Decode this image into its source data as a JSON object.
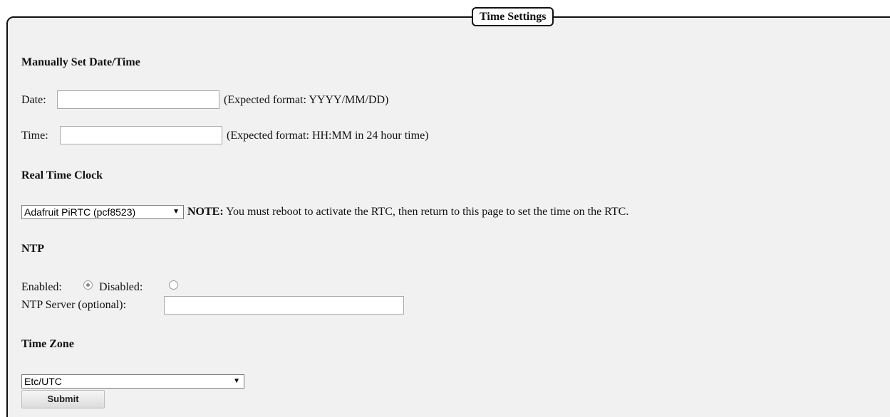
{
  "fieldset": {
    "legend": "Time Settings"
  },
  "manual": {
    "heading": "Manually Set Date/Time",
    "date_label": "Date:",
    "date_value": "",
    "date_hint": "(Expected format: YYYY/MM/DD)",
    "time_label": "Time:",
    "time_value": "",
    "time_hint": "(Expected format: HH:MM in 24 hour time)"
  },
  "rtc": {
    "heading": "Real Time Clock",
    "selected": "Adafruit PiRTC (pcf8523)",
    "note_label": "NOTE:",
    "note_text": "You must reboot to activate the RTC, then return to this page to set the time on the RTC."
  },
  "ntp": {
    "heading": "NTP",
    "enabled_label": "Enabled:",
    "disabled_label": "Disabled:",
    "enabled_checked": true,
    "server_label": "NTP Server (optional):",
    "server_value": ""
  },
  "timezone": {
    "heading": "Time Zone",
    "selected": "Etc/UTC"
  },
  "submit_label": "Submit",
  "colors": {
    "panel_bg": "#f1f1f1",
    "border": "#111111",
    "input_border": "#a9a9a9"
  },
  "icons": {
    "select_arrow": "dropdown-arrow-icon"
  }
}
